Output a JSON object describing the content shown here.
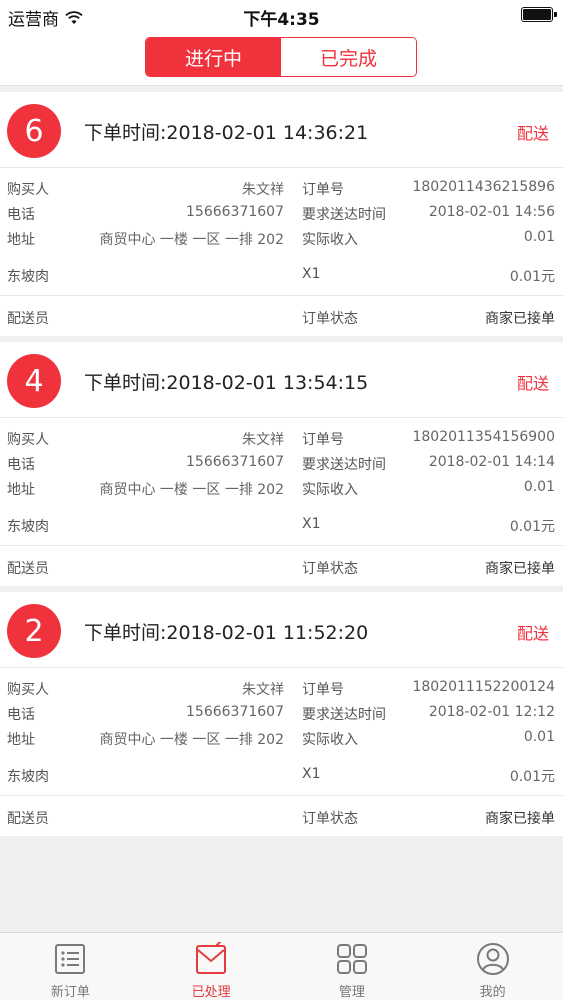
{
  "status_bar": {
    "carrier": "运营商",
    "time": "下午4:35"
  },
  "segments": [
    {
      "label": "进行中",
      "active": true
    },
    {
      "label": "已完成",
      "active": false
    }
  ],
  "labels": {
    "buyer": "购买人",
    "phone": "电话",
    "address": "地址",
    "order_no": "订单号",
    "required_time": "要求送达时间",
    "actual_income": "实际收入",
    "courier": "配送员",
    "order_status": "订单状态",
    "deliver": "配送"
  },
  "orders": [
    {
      "num": "6",
      "order_time": "下单时间:2018-02-01 14:36:21",
      "buyer": "朱文祥",
      "phone": "15666371607",
      "address": "商贸中心 一楼 一区 一排 202",
      "order_no": "1802011436215896",
      "required_time": "2018-02-01 14:56",
      "income": "0.01",
      "item_name": "东坡肉",
      "item_qty": "X1",
      "item_price": "0.01元",
      "status": "商家已接单"
    },
    {
      "num": "4",
      "order_time": "下单时间:2018-02-01 13:54:15",
      "buyer": "朱文祥",
      "phone": "15666371607",
      "address": "商贸中心 一楼 一区 一排 202",
      "order_no": "1802011354156900",
      "required_time": "2018-02-01 14:14",
      "income": "0.01",
      "item_name": "东坡肉",
      "item_qty": "X1",
      "item_price": "0.01元",
      "status": "商家已接单"
    },
    {
      "num": "2",
      "order_time": "下单时间:2018-02-01 11:52:20",
      "buyer": "朱文祥",
      "phone": "15666371607",
      "address": "商贸中心 一楼 一区 一排 202",
      "order_no": "1802011152200124",
      "required_time": "2018-02-01 12:12",
      "income": "0.01",
      "item_name": "东坡肉",
      "item_qty": "X1",
      "item_price": "0.01元",
      "status": "商家已接单"
    }
  ],
  "tabbar": [
    {
      "label": "新订单",
      "icon": "list-icon",
      "active": false
    },
    {
      "label": "已处理",
      "icon": "envelope-check-icon",
      "active": true
    },
    {
      "label": "管理",
      "icon": "grid-icon",
      "active": false
    },
    {
      "label": "我的",
      "icon": "user-icon",
      "active": false
    }
  ],
  "colors": {
    "accent": "#f0323c",
    "tab_active": "#e33b3e"
  }
}
